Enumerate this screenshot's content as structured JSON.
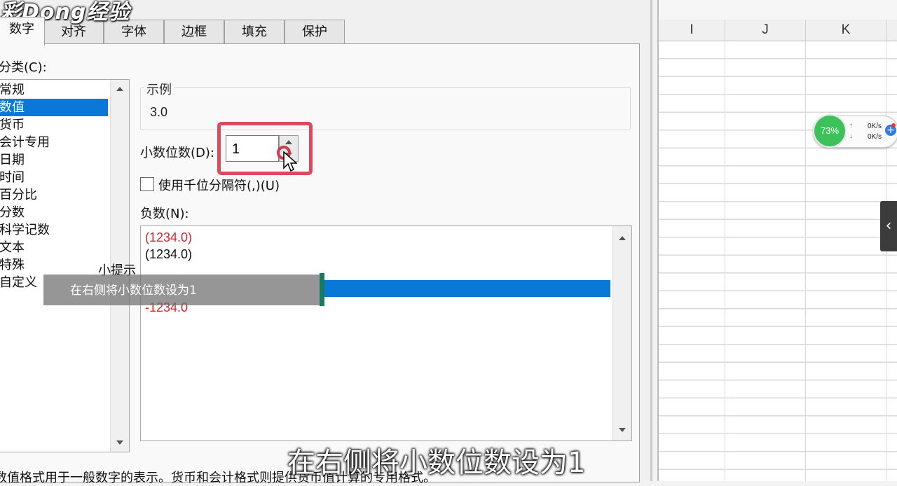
{
  "watermark": {
    "logo_text": "彩Dong经验"
  },
  "dialog": {
    "tabs": [
      "数字",
      "对齐",
      "字体",
      "边框",
      "填充",
      "保护"
    ],
    "active_tab": 0,
    "category_label": "分类(C):",
    "categories": [
      "常规",
      "数值",
      "货币",
      "会计专用",
      "日期",
      "时间",
      "百分比",
      "分数",
      "科学记数",
      "文本",
      "特殊",
      "自定义"
    ],
    "selected_category": 1,
    "sample": {
      "title": "示例",
      "value": "3.0"
    },
    "decimal_places": {
      "label": "小数位数(D):",
      "value": "1"
    },
    "thousands_separator": {
      "label": "使用千位分隔符(,)(U)",
      "checked": false
    },
    "negative_numbers": {
      "label": "负数(N):",
      "items": [
        {
          "text": "(1234.0)",
          "color": "#d0262f"
        },
        {
          "text": "(1234.0)",
          "color": "#111111"
        },
        {
          "text": "-1234.0",
          "color": "#d0262f"
        }
      ]
    },
    "description": "数值格式用于一般数字的表示。货币和会计格式则提供货币值计算的专用格式。"
  },
  "tooltip": {
    "title": "小提示",
    "text": "在右侧将小数位数设为1"
  },
  "caption": "在右侧将小数位数设为1",
  "spreadsheet": {
    "columns": [
      "I",
      "J",
      "K"
    ]
  },
  "speed_widget": {
    "percent": "73%",
    "upload": "0K/s",
    "download": "0K/s"
  },
  "colors": {
    "accent": "#0a78d7",
    "highlight": "#e0485d",
    "negative_red": "#d0262f",
    "widget_green": "#3dc25b"
  }
}
